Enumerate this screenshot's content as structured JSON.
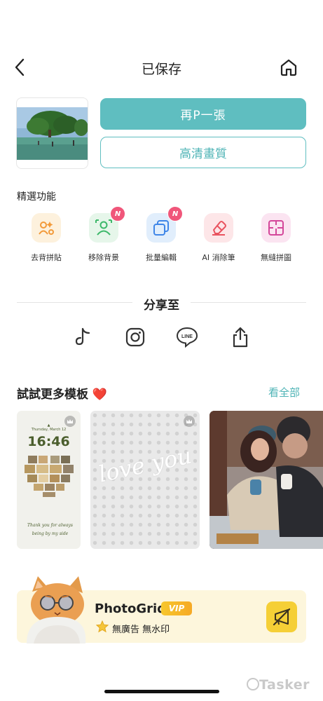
{
  "header": {
    "title": "已保存"
  },
  "actions": {
    "again_label": "再P一張",
    "hd_label": "高清畫質"
  },
  "features": {
    "section_label": "精選功能",
    "items": [
      {
        "label": "去背拼貼",
        "icon": "cutout-collage-icon",
        "bg": "#fdf1dd",
        "new": false
      },
      {
        "label": "移除背景",
        "icon": "remove-bg-icon",
        "bg": "#e6f6ea",
        "new": true
      },
      {
        "label": "批量編輯",
        "icon": "batch-edit-icon",
        "bg": "#e1eefc",
        "new": true
      },
      {
        "label": "AI 消除筆",
        "icon": "ai-eraser-icon",
        "bg": "#fde6e8",
        "new": false
      },
      {
        "label": "無縫拼圖",
        "icon": "seamless-grid-icon",
        "bg": "#fbe4f1",
        "new": false
      }
    ],
    "new_badge": "N"
  },
  "share": {
    "title": "分享至",
    "items": [
      "tiktok-icon",
      "instagram-icon",
      "line-icon",
      "share-icon"
    ],
    "line_text": "LINE"
  },
  "templates": {
    "title": "試試更多模板 ❤️",
    "see_all": "看全部",
    "card1": {
      "time": "16:46",
      "date": "Thursday, March 12",
      "caption": "Thank you for always being by my side"
    },
    "card2": {
      "text": "love you"
    }
  },
  "vip": {
    "app_name": "PhotoGrid",
    "badge": "VIP",
    "features": "無廣告 無水印"
  },
  "watermark": "Tasker",
  "colors": {
    "accent": "#5fbec0",
    "vip_bg": "#fdf6dc",
    "badge": "#f0567a"
  }
}
